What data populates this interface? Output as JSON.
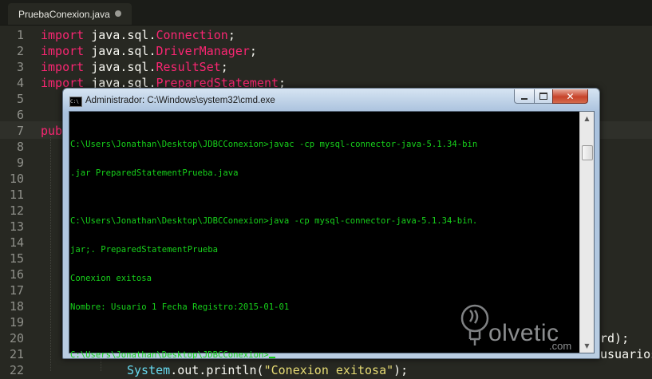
{
  "editor": {
    "tab_label": "PruebaConexion.java",
    "line_numbers": [
      "1",
      "2",
      "3",
      "4",
      "5",
      "6",
      "7",
      "8",
      "9",
      "10",
      "11",
      "12",
      "13",
      "14",
      "15",
      "16",
      "17",
      "18",
      "19",
      "20",
      "21",
      "22"
    ],
    "lines": [
      {
        "kw": "import",
        "rest": " java.sql.",
        "cls": "Connection",
        "end": ";"
      },
      {
        "kw": "import",
        "rest": " java.sql.",
        "cls": "DriverManager",
        "end": ";"
      },
      {
        "kw": "import",
        "rest": " java.sql.",
        "cls": "ResultSet",
        "end": ";"
      },
      {
        "kw": "import",
        "rest": " java.sql.",
        "cls": "PreparedStatement",
        "end": ";"
      }
    ],
    "line7_fragment": "pub",
    "peek_line20": "rd);",
    "peek_line21": "usuarios",
    "bottom_line": {
      "typ": "System",
      "mid": ".out.println(",
      "str": "\"Conexion exitosa\"",
      "end": ");"
    }
  },
  "cmd": {
    "title": "Administrador: C:\\Windows\\system32\\cmd.exe",
    "icon_text": "C:\\",
    "buttons": {
      "close": "✕"
    },
    "console_lines": [
      "C:\\Users\\Jonathan\\Desktop\\JDBCConexion>javac -cp mysql-connector-java-5.1.34-bin",
      ".jar PreparedStatementPrueba.java",
      "",
      "C:\\Users\\Jonathan\\Desktop\\JDBCConexion>java -cp mysql-connector-java-5.1.34-bin.",
      "jar;. PreparedStatementPrueba",
      "Conexion exitosa",
      "Nombre: Usuario 1 Fecha Registro:2015-01-01",
      "",
      "C:\\Users\\Jonathan\\Desktop\\JDBCConexion>"
    ]
  },
  "watermark": {
    "brand": "olvetic",
    "suffix": ".com"
  },
  "colors": {
    "editor_bg": "#272822",
    "keyword": "#f92672",
    "console_text": "#17d21b",
    "string": "#e6db74",
    "type": "#66d9ef"
  }
}
